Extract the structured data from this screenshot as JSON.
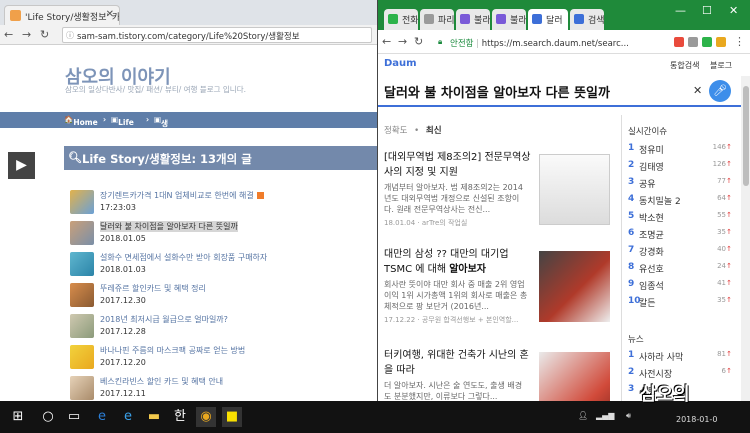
{
  "left_browser": {
    "tabs": [
      {
        "title": "'Life Story/생활정보' 카"
      }
    ],
    "url": "sam-sam.tistory.com/category/Life%20Story/생활정보",
    "blog_title": "삼오의 이야기",
    "blog_desc": "삼오의 일상다반사/ 맛집/ 패션/ 뷰티/ 여행 블로그 입니다.",
    "nav": [
      "Home",
      "Life Story",
      "생활정보"
    ],
    "category_heading": "Life Story/생활정보: 13개의 글",
    "posts": [
      {
        "title": "장기렌트카가격 1대N 업체비교로 한번에 해결",
        "date": "17:23:03",
        "new": true
      },
      {
        "title": "달러와 불 차이점을 알아보자 다른 뜻일까",
        "date": "2018.01.05",
        "selected": true
      },
      {
        "title": "설화수 면세점에서 설화수만 받아 회장품 구매하자",
        "date": "2018.01.03"
      },
      {
        "title": "뚜레쥬르 할인카드 및 혜택 정리",
        "date": "2017.12.30"
      },
      {
        "title": "2018년 최저시급 월급으로 얼마일까?",
        "date": "2017.12.28"
      },
      {
        "title": "바나나핀 주름의 마스크팩 공짜로 얻는 방법",
        "date": "2017.12.20"
      },
      {
        "title": "베스킨라빈스 할인 카드 및 혜택 안내",
        "date": "2017.12.11"
      }
    ]
  },
  "right_browser": {
    "tabs": [
      {
        "title": "전화"
      },
      {
        "title": "파리"
      },
      {
        "title": "불라"
      },
      {
        "title": "불라"
      },
      {
        "title": "달러",
        "active": true
      },
      {
        "title": "검색"
      }
    ],
    "window_controls": [
      "—",
      "☐",
      "✕"
    ],
    "security_label": "안전함",
    "url": "https://m.search.daum.net/searc...",
    "logo": "Daum",
    "header_links": [
      "통합검색",
      "블로그"
    ],
    "query": "달러와 불 차이점을 알아보자 다른 뜻일까",
    "sort_tabs": [
      "정확도",
      "최신"
    ],
    "results": [
      {
        "title_a": "[대외무역법 제8조의2] 전문무역상사의 지정 및 지원",
        "snippet": "개념부터 알아보자. 법 제8조의2는 2014년도 대외무역법 개정으로 신설된 조항이다. 원래 전문무역상사는 전신...",
        "meta": "18.01.04 · arTre의 작업실"
      },
      {
        "title_a": "대만의 삼성 ?? 대만의 대기업 TSMC 에 대해 ",
        "title_b": "알아보자",
        "snippet": "회사란 뜻이야 대만 회사 중 매출 2위 영업이익 1위 시가총액 1위의 회사로 매출은 총체적으로 팡 보단거 (2016년...",
        "meta": "17.12.22 · 공무원 합격선행보 + 본인역할..."
      },
      {
        "title_a": "터키여행, 위대한 건축가 시난의 혼을 따라",
        "snippet": "더 알아보자. 시난은 술 연도도, 출생 배경도 분분했지만, 이류보다 그렇다..."
      }
    ],
    "realtime_heading": "실시간이슈",
    "realtime": [
      {
        "rank": "1",
        "word": "정유미",
        "count": "146"
      },
      {
        "rank": "2",
        "word": "김태영",
        "count": "126"
      },
      {
        "rank": "3",
        "word": "공유",
        "count": "77"
      },
      {
        "rank": "4",
        "word": "동치밀놀 2",
        "count": "64"
      },
      {
        "rank": "5",
        "word": "박소현",
        "count": "55"
      },
      {
        "rank": "6",
        "word": "조명균",
        "count": "35"
      },
      {
        "rank": "7",
        "word": "강경화",
        "count": "40"
      },
      {
        "rank": "8",
        "word": "유선호",
        "count": "24"
      },
      {
        "rank": "9",
        "word": "임종석",
        "count": "41"
      },
      {
        "rank": "10",
        "word": "칼든",
        "count": "35"
      }
    ],
    "news_heading": "뉴스",
    "news": [
      {
        "rank": "1",
        "word": "사하라 사막",
        "count": "81"
      },
      {
        "rank": "2",
        "word": "사전시장",
        "count": "6"
      },
      {
        "rank": "3",
        "word": "스트",
        "count": ""
      }
    ]
  },
  "taskbar": {
    "time": "2018-01-0",
    "watermark": "삼오의"
  },
  "colors": {
    "accent_blue": "#3d6fd8",
    "blog_nav": "#5f7ea9",
    "chrome_green": "#1f8a3a"
  }
}
